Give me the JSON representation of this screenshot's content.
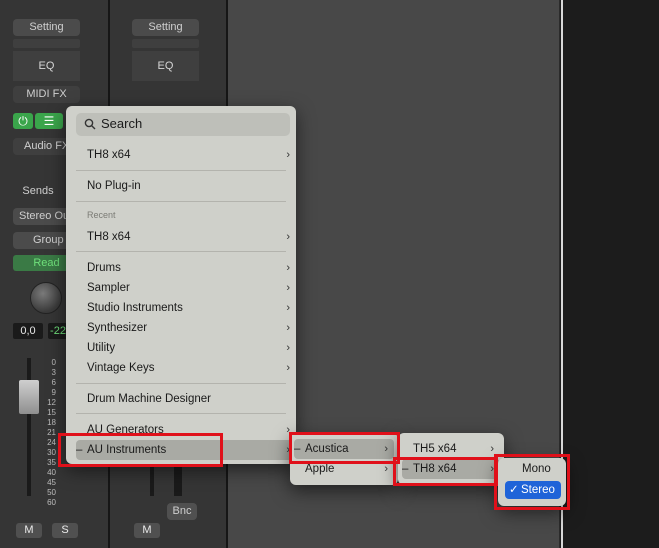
{
  "mixer": {
    "strip1": {
      "setting": "Setting",
      "eq": "EQ",
      "midi_fx": "MIDI FX",
      "audio_fx": "Audio FX",
      "sends": "Sends",
      "stereo_out": "Stereo Out",
      "group": "Group",
      "read": "Read",
      "volume_value": "0,0",
      "peak_value": "-22",
      "mute": "M",
      "solo": "S"
    },
    "strip2": {
      "setting": "Setting",
      "eq": "EQ",
      "bnc": "Bnc",
      "mute": "M"
    },
    "scale_marks": [
      "0",
      "3",
      "6",
      "9",
      "12",
      "15",
      "18",
      "21",
      "24",
      "30",
      "35",
      "40",
      "45",
      "50",
      "60"
    ]
  },
  "main_menu": {
    "search_placeholder": "Search",
    "items_top": [
      {
        "label": "TH8 x64",
        "submenu": true
      },
      {
        "label": "No Plug-in",
        "submenu": false
      }
    ],
    "recent_header": "Recent",
    "recent_item": "TH8 x64",
    "categories": [
      "Drums",
      "Sampler",
      "Studio Instruments",
      "Synthesizer",
      "Utility",
      "Vintage Keys"
    ],
    "drum_machine": "Drum Machine Designer",
    "au_generators": "AU Generators",
    "au_instruments": "AU Instruments",
    "dash": "–",
    "chevron": "›"
  },
  "sub_menu_1": {
    "items": [
      "Acustica",
      "Apple"
    ]
  },
  "sub_menu_2": {
    "items": [
      "TH5 x64",
      "TH8 x64"
    ]
  },
  "sub_menu_3": {
    "mono": "Mono",
    "stereo": "Stereo",
    "check": "✓"
  },
  "colors": {
    "highlight_red": "#e0101a",
    "selected_blue": "#1f63d8",
    "menu_bg": "#cfd0ca"
  }
}
